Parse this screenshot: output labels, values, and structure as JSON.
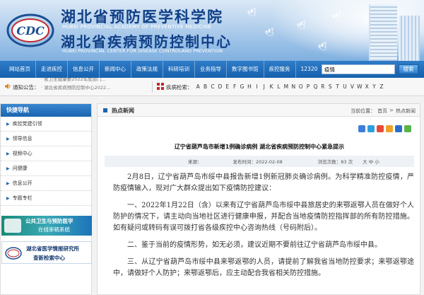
{
  "header": {
    "title_cn_1": "湖北省预防医学科学院",
    "title_en_1": "HUBEI PROVINCIAL ACADEMY OF PREVENTIVE MEDICINE",
    "title_cn_2": "湖北省疾病预防控制中心",
    "title_en_2": "HUBEI PROVINCIAL CENTER FOR DISEASE CONTROLAND PREVENTION",
    "logo_text": "CDC"
  },
  "nav": {
    "items": [
      "网站首页",
      "走进疾控",
      "信息公开",
      "新闻中心",
      "政策法规",
      "科研培训",
      "业务指导",
      "数字图书馆",
      "疾控服务",
      "12320"
    ],
    "search_value": "疫情",
    "search_button": "搜索"
  },
  "notice": {
    "label": "通知公告：",
    "lines": [
      "· 省卫生健康委2022年度部门...",
      "· 湖北省疾病预防控制中心2022..."
    ]
  },
  "disease": {
    "label": "疾病检索：",
    "letters": [
      "A",
      "B",
      "C",
      "D",
      "E",
      "F",
      "G",
      "H",
      "I",
      "J",
      "K",
      "L",
      "M",
      "N",
      "O",
      "P",
      "Q",
      "R",
      "S",
      "T",
      "U",
      "V",
      "W",
      "X",
      "Y",
      "Z"
    ]
  },
  "sidebar": {
    "title": "快捷导航",
    "items": [
      "疾控党建引领",
      "领导信息",
      "视频中心",
      "问健康",
      "信息公开",
      "专题专栏"
    ],
    "ad1_line1": "公共卫生与预防医学",
    "ad1_line2": "在线审稿系统",
    "ad2_line1": "湖北省医学情报研究所",
    "ad2_line2": "查新检索中心"
  },
  "main": {
    "section_title": "热点新闻",
    "breadcrumb": [
      "当前位置：",
      "首页",
      ">",
      "热点新闻"
    ],
    "article_title": "辽宁省葫芦岛市新增1例确诊病例  湖北省疾病预防控制中心紧急提示",
    "meta": {
      "source": "来源：",
      "date": "发布时间：2022-02-08",
      "views": "浏览次数：83 次",
      "font_size": "大 中 小"
    },
    "paragraphs": [
      "2月8日，辽宁省葫芦岛市绥中县报告新增1例新冠肺炎确诊病例。为科学精准防控疫情，严防疫情输入，现对广大群众提出如下疫情防控建议：",
      "一、2022年1月22日（含）以来有辽宁省葫芦岛市绥中县旅居史的来鄂返鄂人员在做好个人防护的情况下，请主动向当地社区进行健康申报，并配合当地疫情防控指挥部的所有防控措施。如有疑问或转码有误可拨打省各级疾控中心咨询热线（号码附后）。",
      "二、鉴于当前的疫情形势，如无必须，建议近期不要前往辽宁省葫芦岛市绥中县。",
      "三、从辽宁省葫芦岛市绥中县来鄂返鄂的人员，请提前了解我省当地防控要求；来鄂返鄂途中，请做好个人防护；来鄂返鄂后，应主动配合我省相关防控措施。"
    ]
  },
  "colors": {
    "nav_blue": "#1761ad",
    "title_blue": "#0f3f86"
  }
}
